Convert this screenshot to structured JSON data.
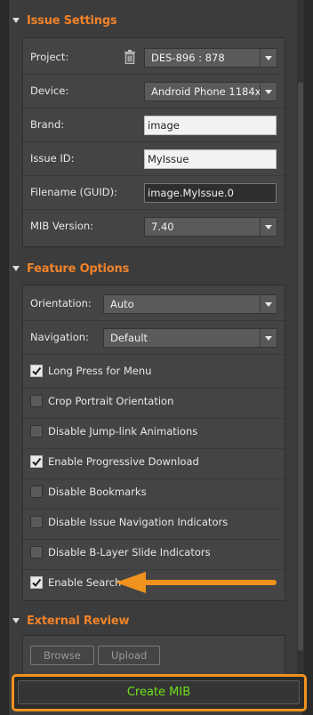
{
  "issue_settings": {
    "title": "Issue Settings",
    "project_label": "Project:",
    "project_value": "DES-896 : 878",
    "device_label": "Device:",
    "device_value": "Android Phone 1184x...",
    "brand_label": "Brand:",
    "brand_value": "image",
    "issue_id_label": "Issue ID:",
    "issue_id_value": "MyIssue",
    "filename_label": "Filename (GUID):",
    "filename_value": "image.MyIssue.0",
    "mib_label": "MIB Version:",
    "mib_value": "7.40"
  },
  "feature_options": {
    "title": "Feature Options",
    "orientation_label": "Orientation:",
    "orientation_value": "Auto",
    "navigation_label": "Navigation:",
    "navigation_value": "Default",
    "checkboxes": [
      {
        "label": "Long Press for Menu",
        "checked": true
      },
      {
        "label": "Crop Portrait Orientation",
        "checked": false
      },
      {
        "label": "Disable Jump-link Animations",
        "checked": false
      },
      {
        "label": "Enable Progressive Download",
        "checked": true
      },
      {
        "label": "Disable Bookmarks",
        "checked": false
      },
      {
        "label": "Disable Issue Navigation Indicators",
        "checked": false
      },
      {
        "label": "Disable B-Layer Slide Indicators",
        "checked": false
      },
      {
        "label": "Enable Search",
        "checked": true
      }
    ]
  },
  "external_review": {
    "title": "External Review",
    "browse_label": "Browse",
    "upload_label": "Upload"
  },
  "create_button_label": "Create MIB",
  "colors": {
    "accent": "#f0832a",
    "highlight": "#f0931e",
    "create_text": "#6ee01a"
  }
}
